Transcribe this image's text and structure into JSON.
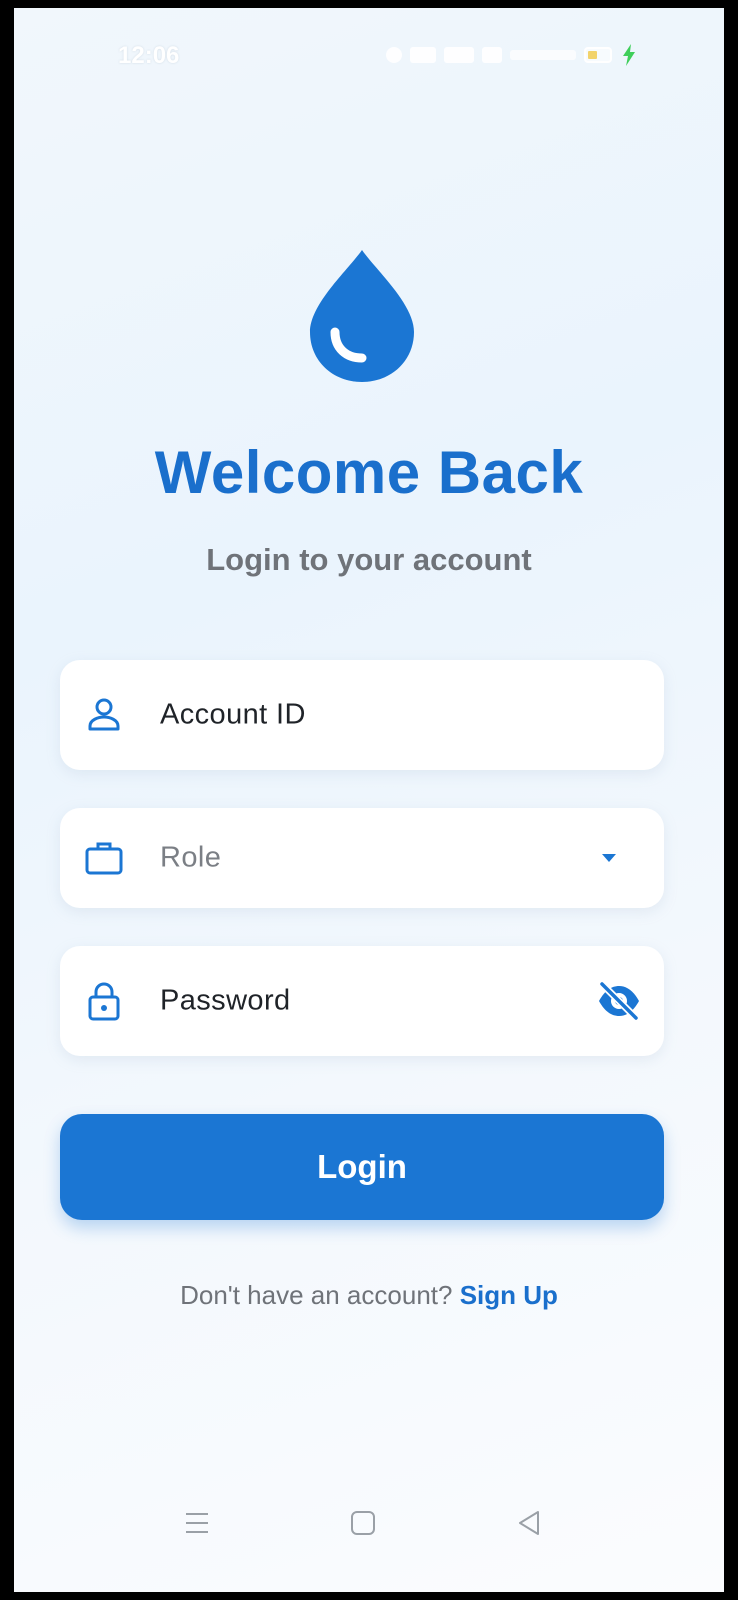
{
  "status_bar": {
    "time": "12:06"
  },
  "header": {
    "title": "Welcome Back",
    "subtitle": "Login to your account"
  },
  "form": {
    "account_id": {
      "label": "Account ID",
      "icon": "person-icon"
    },
    "role": {
      "placeholder": "Role",
      "icon": "briefcase-icon"
    },
    "password": {
      "label": "Password",
      "icon": "lock-icon",
      "toggle_icon": "eye-off-icon"
    }
  },
  "actions": {
    "login_label": "Login",
    "signup_prompt": "Don't have an account?",
    "signup_label": "Sign Up"
  },
  "colors": {
    "primary": "#1b76d3",
    "title": "#1a6fcc",
    "muted_text": "#6f7379",
    "background": "#eef5fc"
  }
}
